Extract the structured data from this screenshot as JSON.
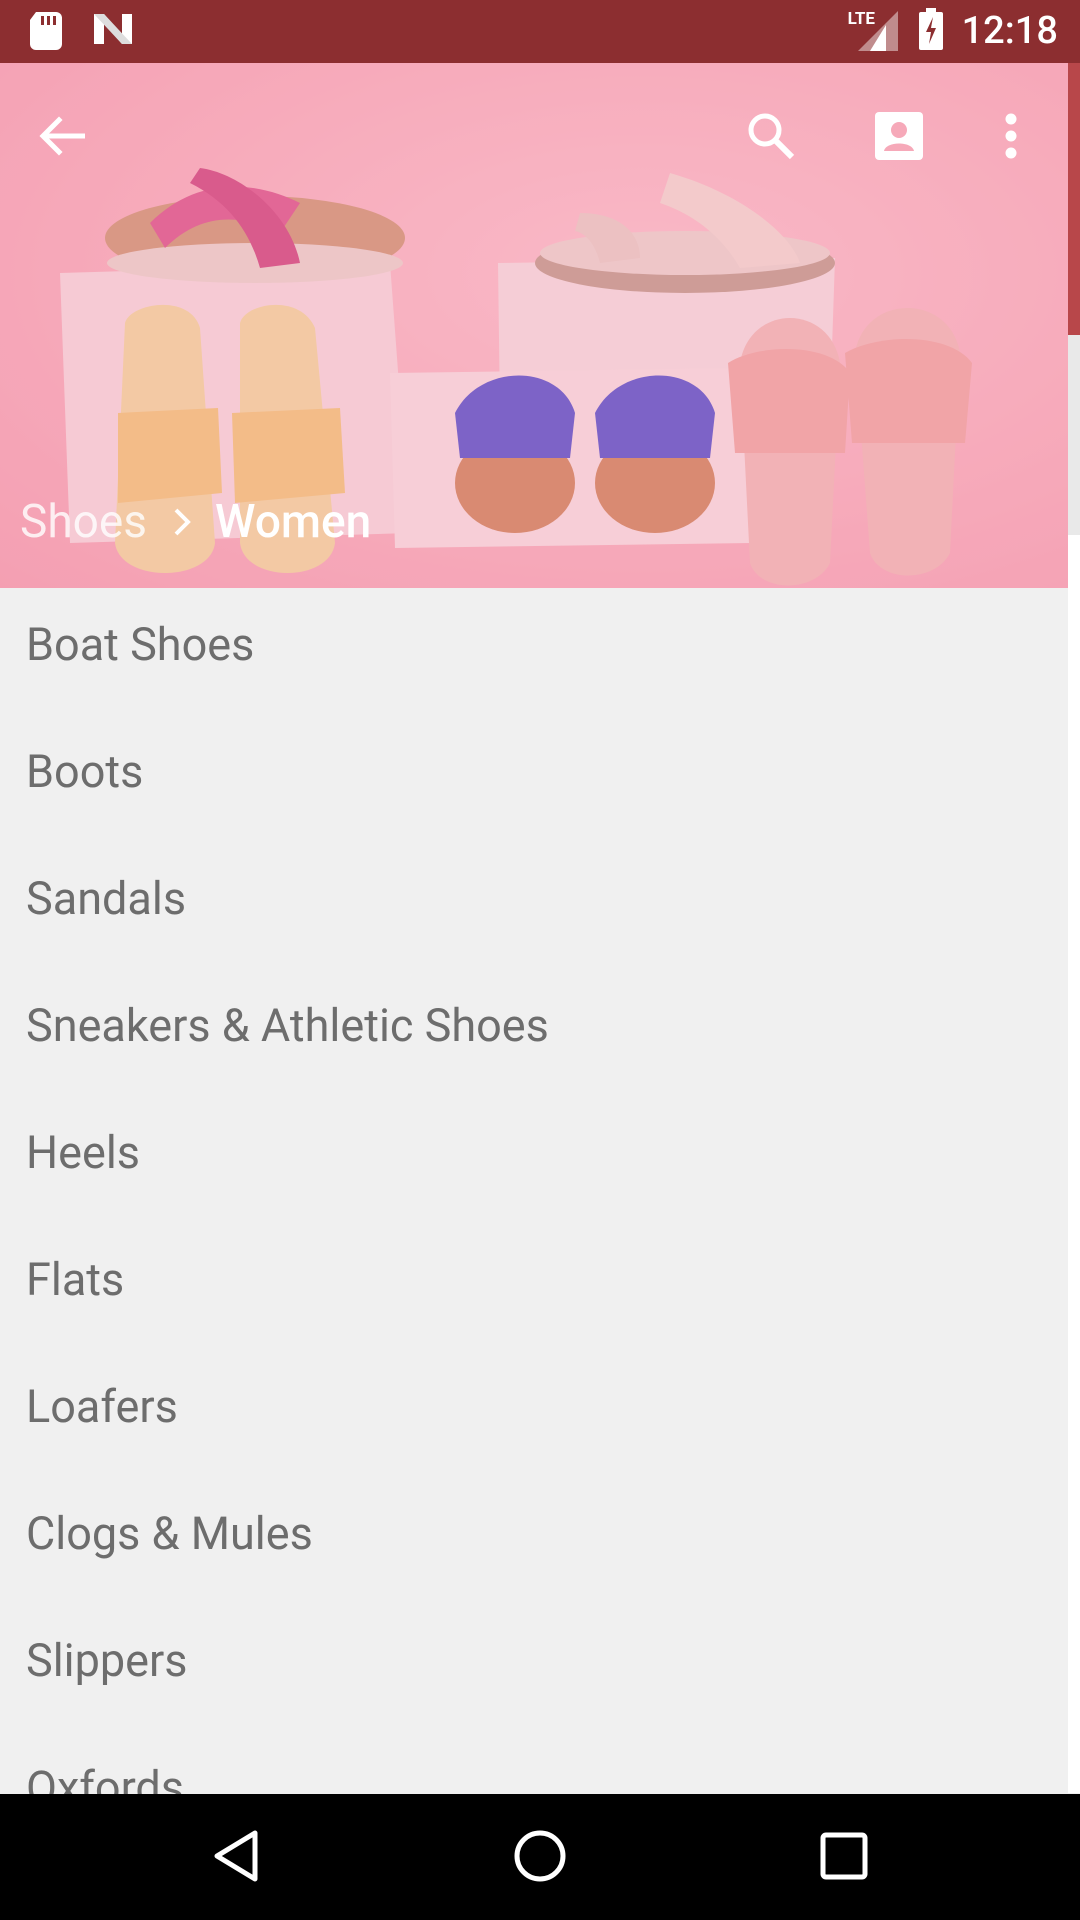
{
  "status_bar": {
    "time": "12:18",
    "network": "LTE",
    "icons": [
      "sd-card-icon",
      "n-logo-icon",
      "lte-signal-icon",
      "battery-charging-icon"
    ]
  },
  "toolbar": {
    "icons": [
      "back-arrow-icon",
      "search-icon",
      "account-icon",
      "more-vert-icon"
    ]
  },
  "breadcrumb": {
    "parent": "Shoes",
    "current": "Women"
  },
  "categories": [
    "Boat Shoes",
    "Boots",
    "Sandals",
    "Sneakers & Athletic Shoes",
    "Heels",
    "Flats",
    "Loafers",
    "Clogs & Mules",
    "Slippers",
    "Oxfords"
  ],
  "nav_bar": {
    "icons": [
      "back-triangle-icon",
      "home-circle-icon",
      "recents-square-icon"
    ]
  },
  "colors": {
    "status_bar": "#8c2e30",
    "header_pink": "#f7adbd",
    "list_bg": "#f0f0f0",
    "list_text": "#6d6d6d"
  }
}
